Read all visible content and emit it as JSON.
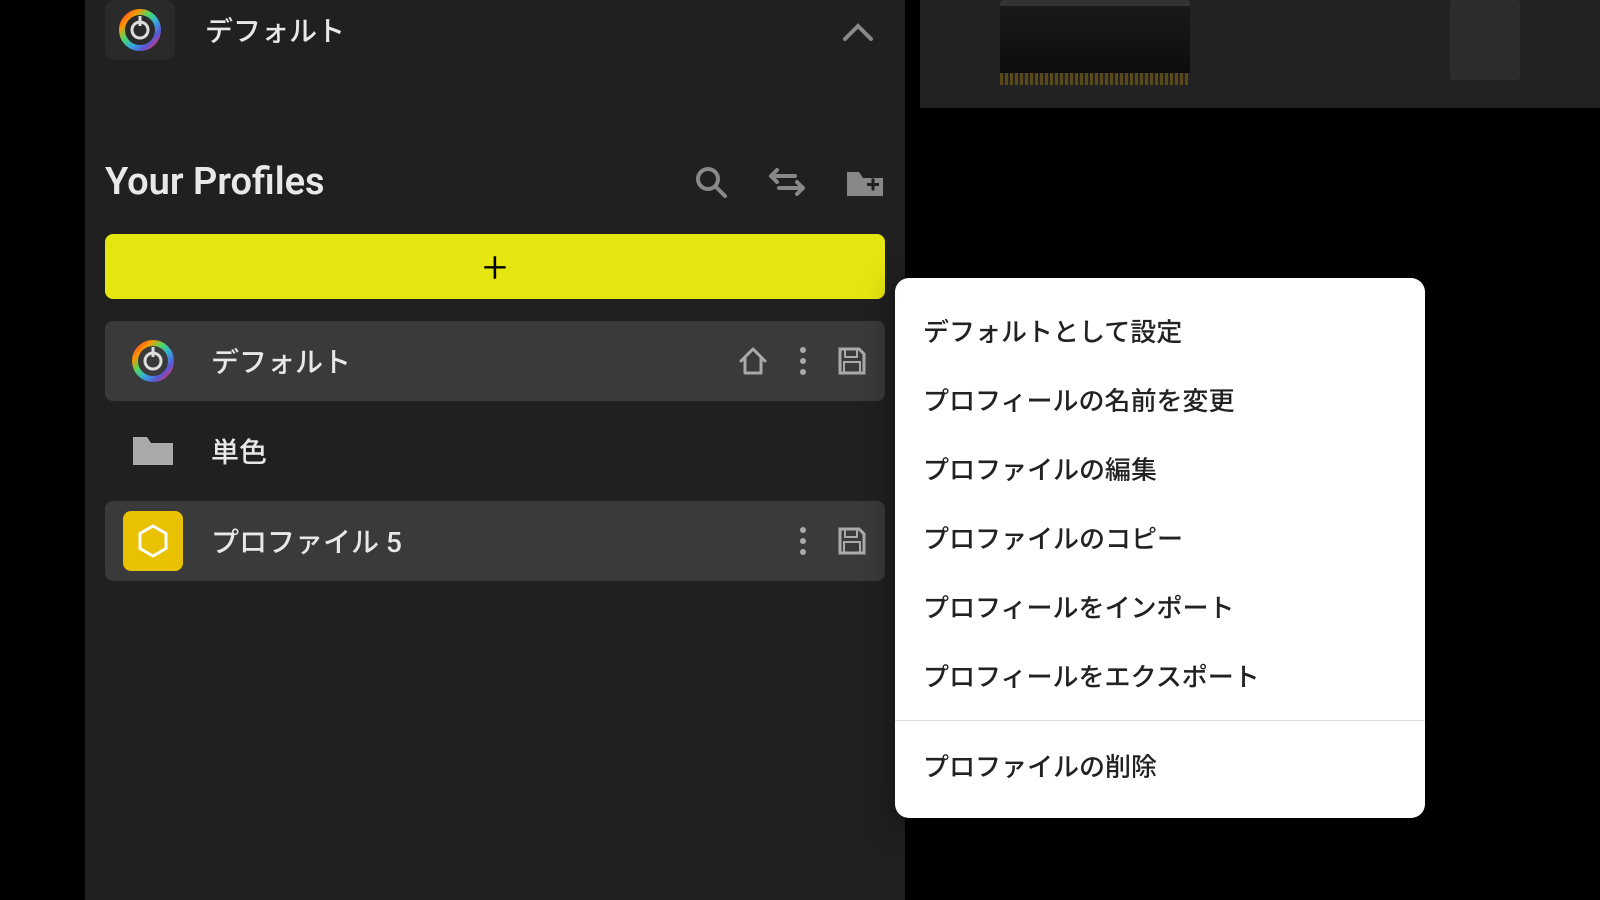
{
  "header": {
    "title": "デフォルト"
  },
  "profiles_section": {
    "title": "Your Profiles"
  },
  "profiles": [
    {
      "label": "デフォルト",
      "type": "default"
    },
    {
      "label": "単色",
      "type": "folder"
    },
    {
      "label": "プロファイル 5",
      "type": "profile"
    }
  ],
  "context_menu": {
    "set_default": "デフォルトとして設定",
    "rename": "プロフィールの名前を変更",
    "edit": "プロファイルの編集",
    "copy": "プロファイルのコピー",
    "import": "プロフィールをインポート",
    "export": "プロフィールをエクスポート",
    "delete": "プロファイルの削除"
  }
}
